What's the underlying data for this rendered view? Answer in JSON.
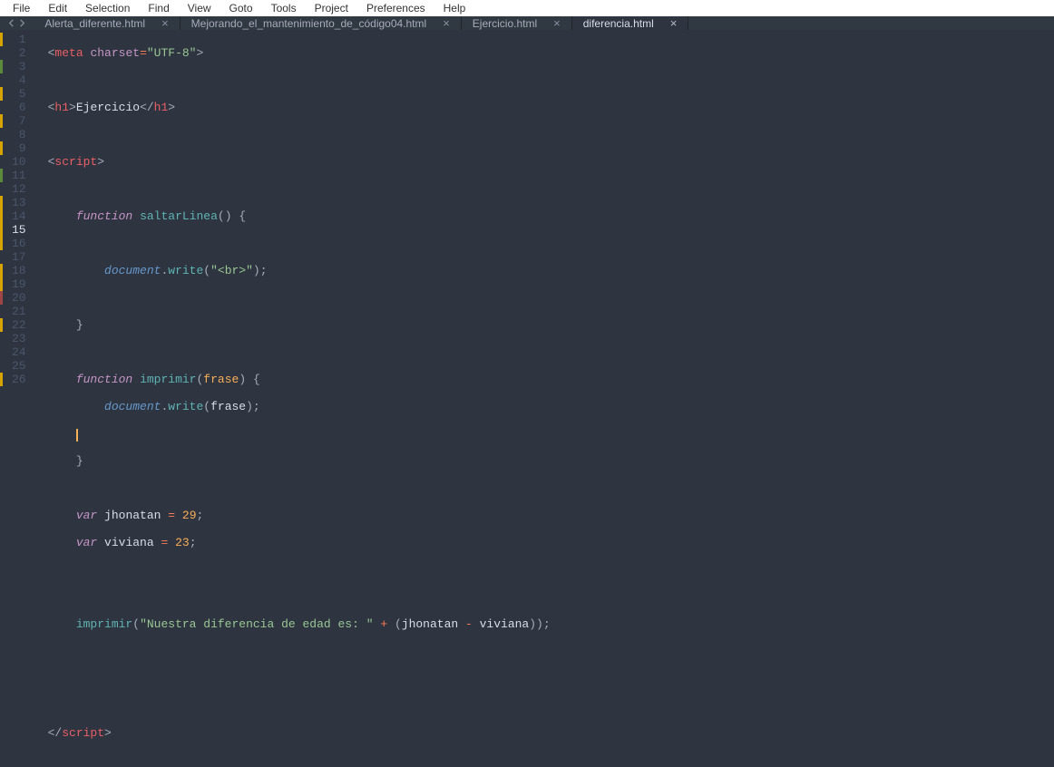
{
  "menu": [
    "File",
    "Edit",
    "Selection",
    "Find",
    "View",
    "Goto",
    "Tools",
    "Project",
    "Preferences",
    "Help"
  ],
  "tabs": [
    {
      "label": "Alerta_diferente.html",
      "active": false
    },
    {
      "label": "Mejorando_el_mantenimiento_de_código04.html",
      "active": false
    },
    {
      "label": "Ejercicio.html",
      "active": false
    },
    {
      "label": "diferencia.html",
      "active": true
    }
  ],
  "gutter": {
    "lines": 26,
    "current": 15,
    "marks": {
      "yellow": [
        1,
        5,
        7,
        9,
        13,
        14,
        15,
        16,
        18,
        19,
        22,
        26
      ],
      "green": [
        3,
        11
      ],
      "red": [
        20
      ]
    }
  },
  "code": {
    "l1": {
      "tag": "meta",
      "attr": "charset",
      "val": "\"UTF-8\""
    },
    "l3": {
      "open": "h1",
      "text": "Ejercicio",
      "close": "h1"
    },
    "l5": {
      "open": "script"
    },
    "l7": {
      "kw": "function",
      "name": "saltarLinea"
    },
    "l9": {
      "obj": "document",
      "call": "write",
      "arg": "\"<br>\""
    },
    "l13": {
      "kw": "function",
      "name": "imprimir",
      "param": "frase"
    },
    "l14": {
      "obj": "document",
      "call": "write",
      "arg": "frase"
    },
    "l18": {
      "kw": "var",
      "name": "jhonatan",
      "val": "29"
    },
    "l19": {
      "kw": "var",
      "name": "viviana",
      "val": "23"
    },
    "l22": {
      "call": "imprimir",
      "str": "\"Nuestra diferencia de edad es: \"",
      "a": "jhonatan",
      "b": "viviana"
    },
    "l26": {
      "close": "script"
    }
  }
}
